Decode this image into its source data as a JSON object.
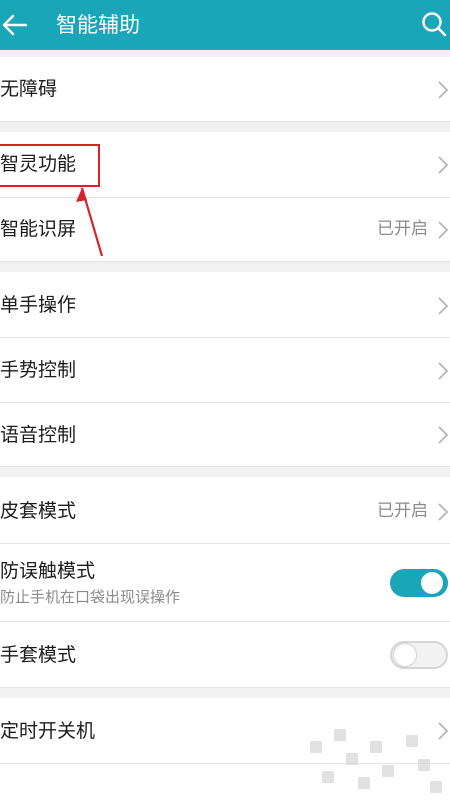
{
  "header": {
    "title": "智能辅助",
    "back_icon": "arrow-left-icon",
    "search_icon": "search-icon"
  },
  "colors": {
    "accent": "#1aa5b8",
    "annotation": "#d9222a"
  },
  "rows": {
    "accessibility": {
      "label": "无障碍"
    },
    "smart_assist": {
      "label": "智灵功能"
    },
    "smart_screen": {
      "label": "智能识屏",
      "status": "已开启"
    },
    "one_hand": {
      "label": "单手操作"
    },
    "gesture": {
      "label": "手势控制"
    },
    "voice": {
      "label": "语音控制"
    },
    "cover_mode": {
      "label": "皮套模式",
      "status": "已开启"
    },
    "accidental_touch": {
      "label": "防误触模式",
      "sublabel": "防止手机在口袋出现误操作",
      "toggle_on": true
    },
    "glove_mode": {
      "label": "手套模式",
      "toggle_on": false
    },
    "scheduled_power": {
      "label": "定时开关机"
    }
  }
}
